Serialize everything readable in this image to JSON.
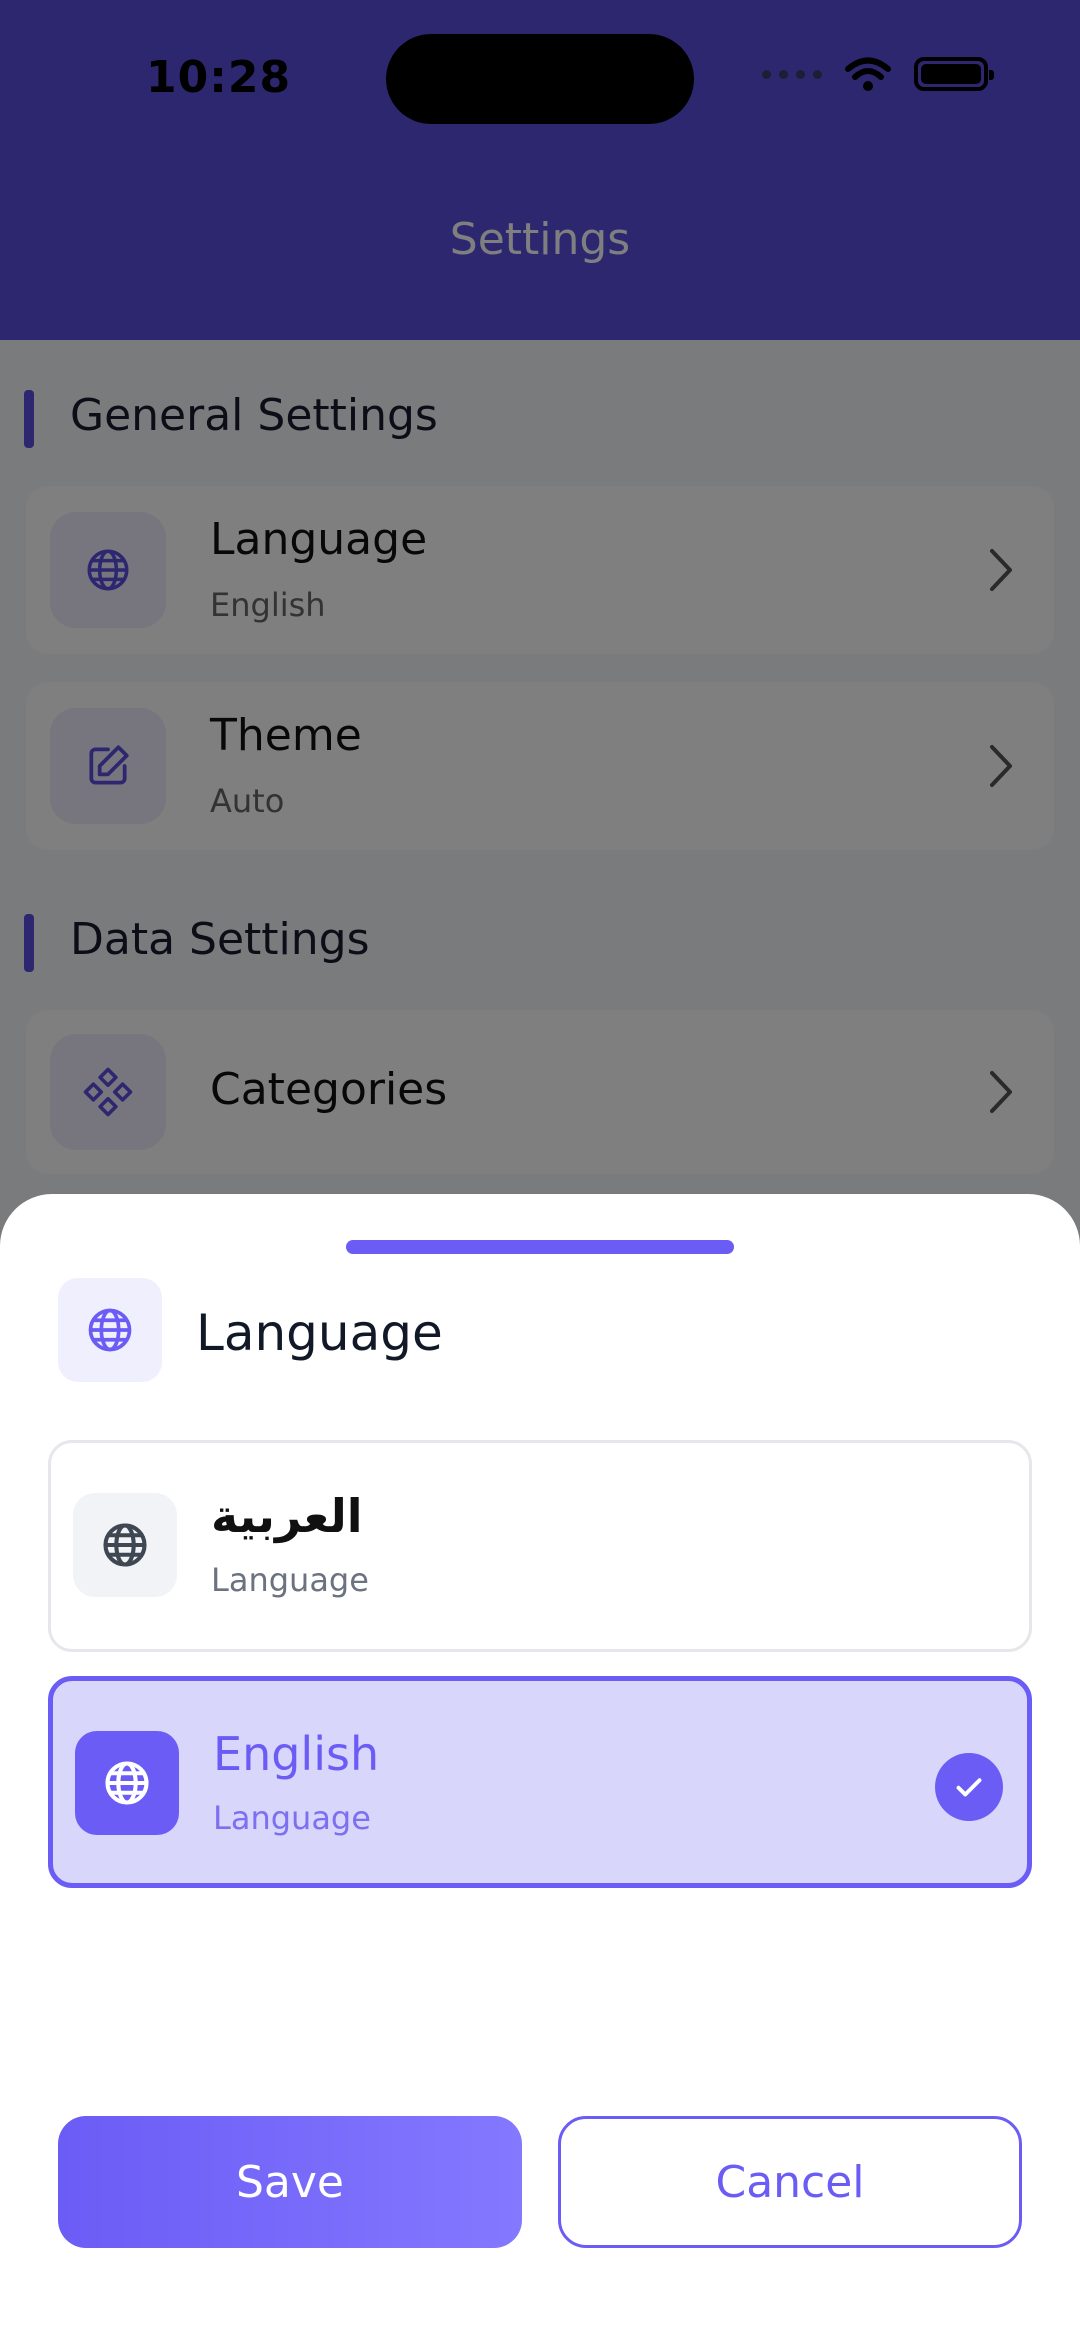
{
  "status_bar": {
    "time": "10:28"
  },
  "header": {
    "title": "Settings"
  },
  "sections": {
    "general": "General Settings",
    "data": "Data Settings"
  },
  "settings": {
    "language": {
      "title": "Language",
      "value": "English"
    },
    "theme": {
      "title": "Theme",
      "value": "Auto"
    },
    "categories": {
      "title": "Categories"
    }
  },
  "sheet": {
    "title": "Language",
    "options": [
      {
        "title": "العربية",
        "subtitle": "Language",
        "selected": false
      },
      {
        "title": "English",
        "subtitle": "Language",
        "selected": true
      }
    ],
    "save_label": "Save",
    "cancel_label": "Cancel"
  },
  "colors": {
    "accent": "#6b5cf5",
    "header": "#5a4ee0",
    "selected_bg": "#d8d6fb"
  },
  "icons": {
    "language": "globe-icon",
    "theme": "edit-icon",
    "categories": "categories-icon",
    "chevron": "chevron-right-icon",
    "check": "check-icon"
  }
}
